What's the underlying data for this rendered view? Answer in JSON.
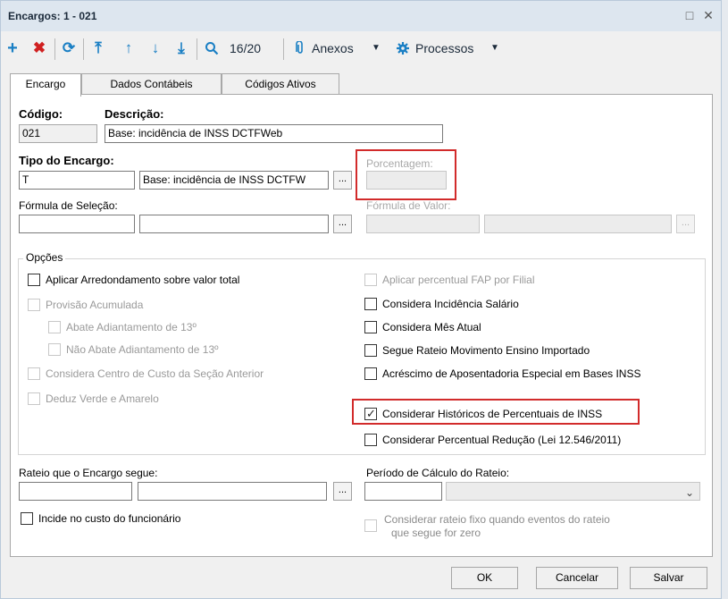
{
  "window": {
    "title": "Encargos: 1 - 021",
    "restore_glyph": "□",
    "close_glyph": "✕"
  },
  "toolbar": {
    "add_icon": "+",
    "delete_icon": "✖",
    "refresh_icon": "⟳",
    "first_icon": "⤒",
    "prev_icon": "↑",
    "next_icon": "↓",
    "last_icon": "⤓",
    "search_icon": "🔍",
    "record_position": "16/20",
    "attachments_label": "Anexos",
    "processes_label": "Processos",
    "dropdown_glyph": "▼"
  },
  "tabs": [
    "Encargo",
    "Dados Contábeis",
    "Códigos Ativos"
  ],
  "form": {
    "codigo_label": "Código:",
    "codigo_value": "021",
    "descricao_label": "Descrição:",
    "descricao_value": "Base: incidência de INSS DCTFWeb",
    "tipo_label": "Tipo do Encargo:",
    "tipo_code": "T",
    "tipo_desc": "Base: incidência de INSS DCTFW",
    "porcentagem_label": "Porcentagem:",
    "porcentagem_value": "",
    "formula_selecao_label": "Fórmula de Seleção:",
    "formula_valor_label": "Fórmula de Valor:",
    "ellipsis": "..."
  },
  "options": {
    "group_label": "Opções",
    "left": [
      {
        "label": "Aplicar Arredondamento sobre valor total",
        "checked": false,
        "enabled": true
      },
      {
        "label": "Provisão Acumulada",
        "checked": false,
        "enabled": false
      },
      {
        "label": "Abate Adiantamento de 13º",
        "checked": false,
        "enabled": false
      },
      {
        "label": "Não Abate Adiantamento de 13º",
        "checked": false,
        "enabled": false
      },
      {
        "label": "Considera Centro de Custo da Seção Anterior",
        "checked": false,
        "enabled": false
      },
      {
        "label": "Deduz Verde e Amarelo",
        "checked": false,
        "enabled": false
      }
    ],
    "right": [
      {
        "label": "Aplicar percentual FAP por Filial",
        "checked": false,
        "enabled": false
      },
      {
        "label": "Considera Incidência Salário",
        "checked": false,
        "enabled": true
      },
      {
        "label": "Considera Mês Atual",
        "checked": false,
        "enabled": true
      },
      {
        "label": "Segue Rateio Movimento Ensino Importado",
        "checked": false,
        "enabled": true
      },
      {
        "label": "Acréscimo de Aposentadoria Especial em Bases INSS",
        "checked": false,
        "enabled": true
      },
      {
        "label": "Considerar Históricos de Percentuais de INSS",
        "checked": true,
        "enabled": true
      },
      {
        "label": "Considerar Percentual Redução (Lei 12.546/2011)",
        "checked": false,
        "enabled": true
      }
    ],
    "check_glyph": "✓"
  },
  "rateio": {
    "rateio_label": "Rateio que o Encargo segue:",
    "periodo_label": "Período de Cálculo do Rateio:",
    "select_arrow": "⌄",
    "incide_label": "Incide no custo do funcionário",
    "fixo_label_line1": "Considerar rateio fixo quando eventos do rateio",
    "fixo_label_line2": "que segue for zero"
  },
  "buttons": {
    "ok": "OK",
    "cancel": "Cancelar",
    "save": "Salvar"
  },
  "colors": {
    "highlight": "#d22b2b",
    "add": "#1a7fc4",
    "delete": "#d02020"
  }
}
